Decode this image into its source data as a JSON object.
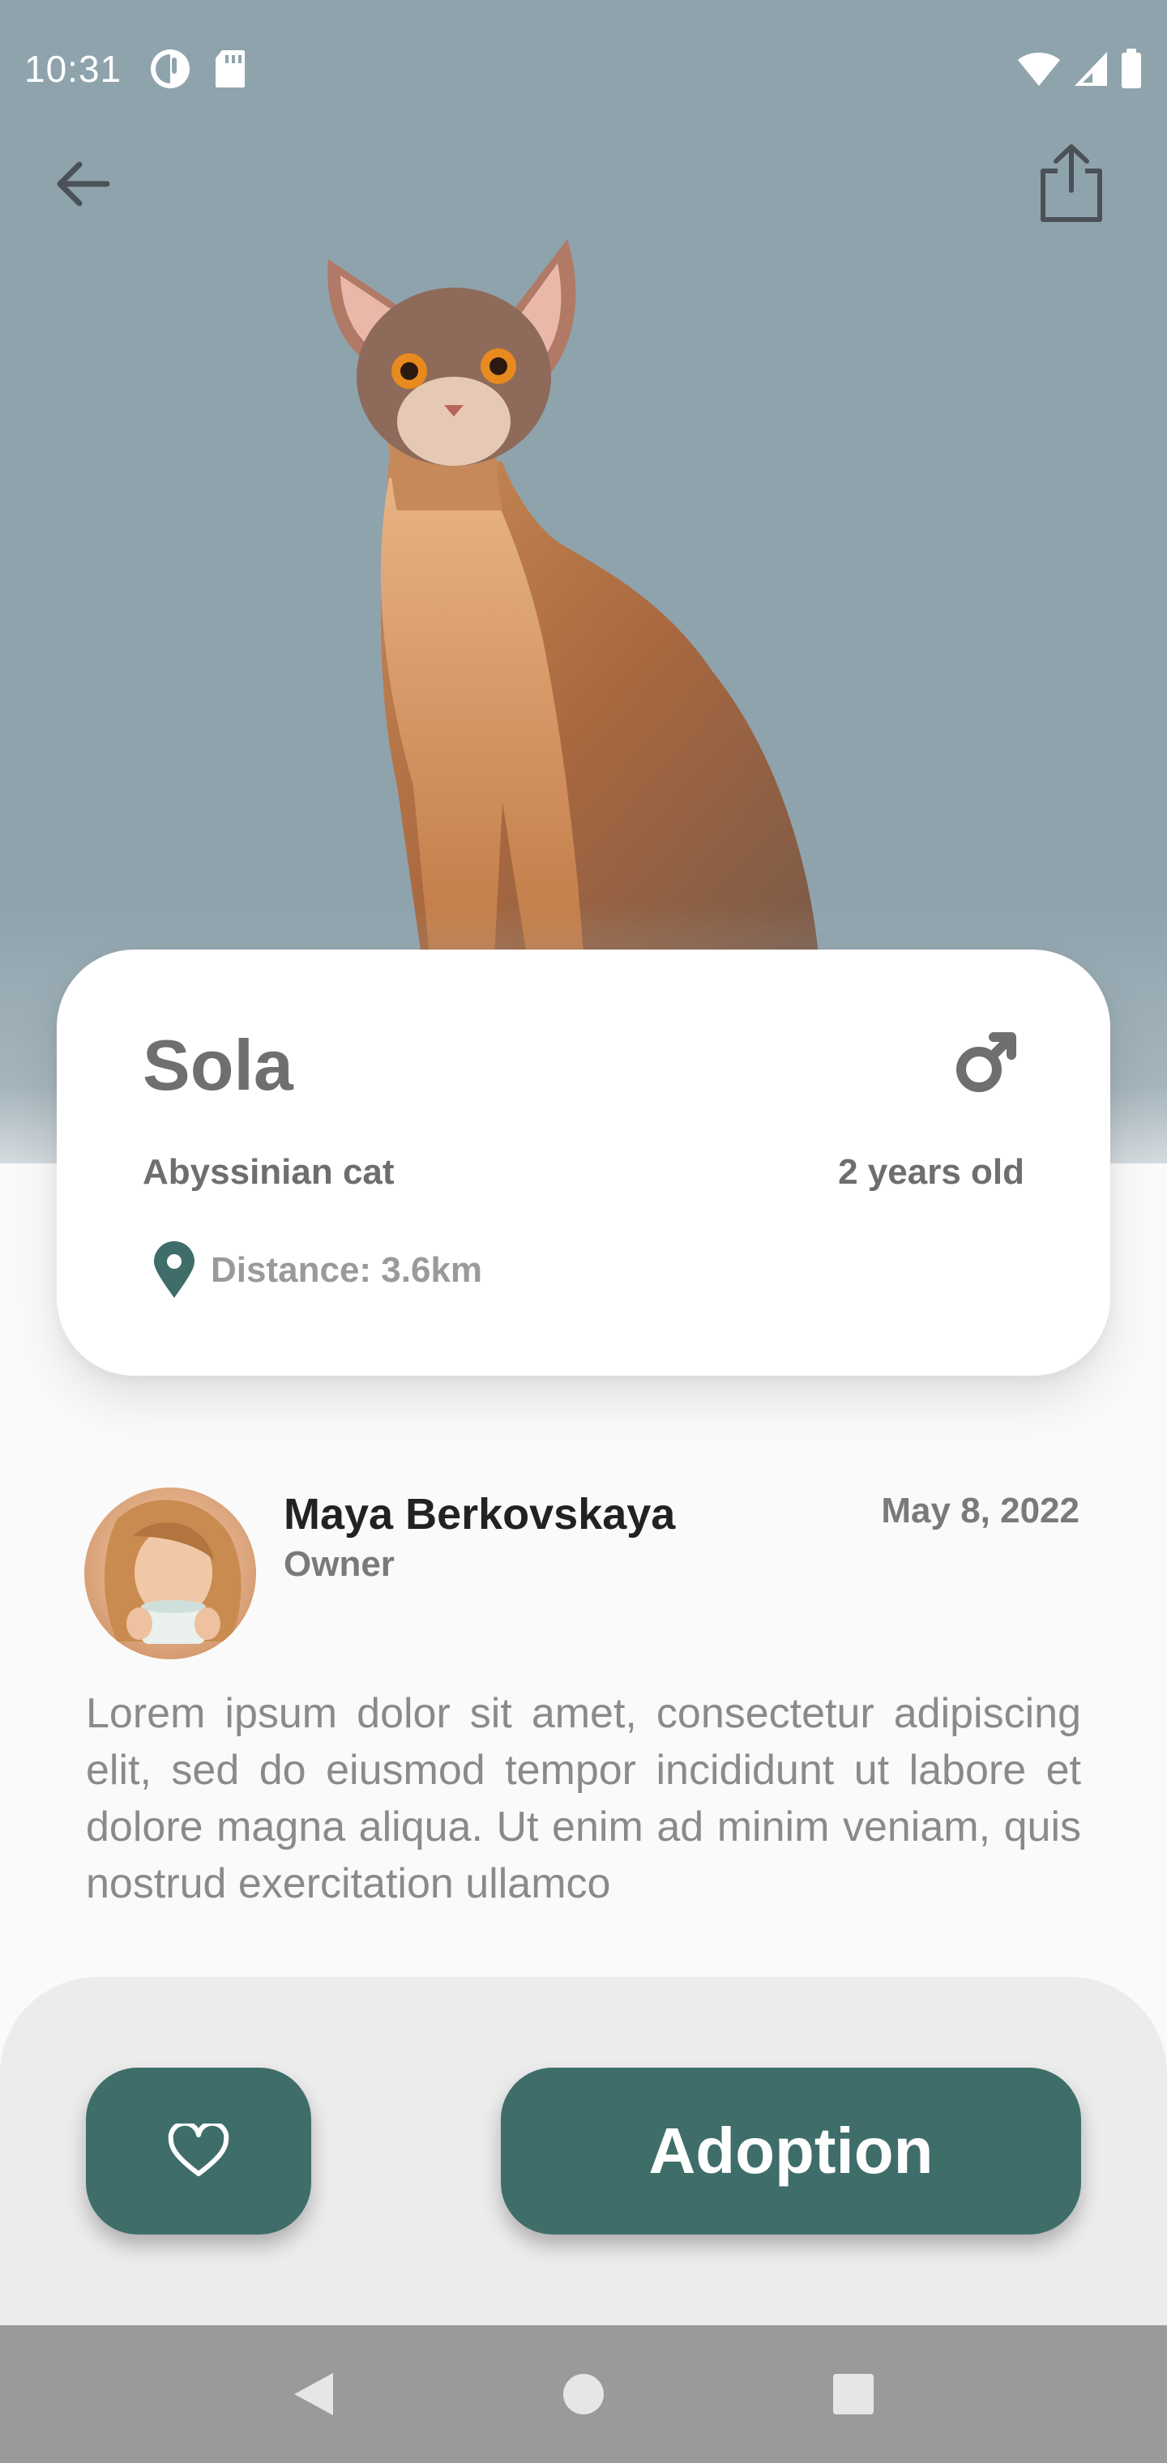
{
  "status_bar": {
    "time": "10:31"
  },
  "hero": {
    "background_color": "#8fa3ad",
    "image": "abyssinian-cat-photo",
    "back_icon": "arrow-left-icon",
    "share_icon": "share-icon"
  },
  "pet": {
    "name": "Sola",
    "gender_icon": "male-icon",
    "breed": "Abyssinian cat",
    "age": "2 years old",
    "distance": "Distance: 3.6km",
    "distance_icon": "map-pin-icon"
  },
  "owner": {
    "name": "Maya Berkovskaya",
    "role": "Owner",
    "date": "May 8, 2022",
    "avatar_icon": "avatar"
  },
  "description": "Lorem ipsum dolor sit amet, consectetur adipiscing elit, sed do eiusmod tempor incididunt ut labore et dolore magna aliqua. Ut enim ad minim veniam, quis nostrud exercitation ullamco",
  "actions": {
    "favorite_icon": "heart-icon",
    "adoption_label": "Adoption",
    "accent_color": "#3f6e6a"
  },
  "nav": {
    "back_icon": "nav-back-icon",
    "home_icon": "nav-home-icon",
    "recents_icon": "nav-recents-icon"
  }
}
